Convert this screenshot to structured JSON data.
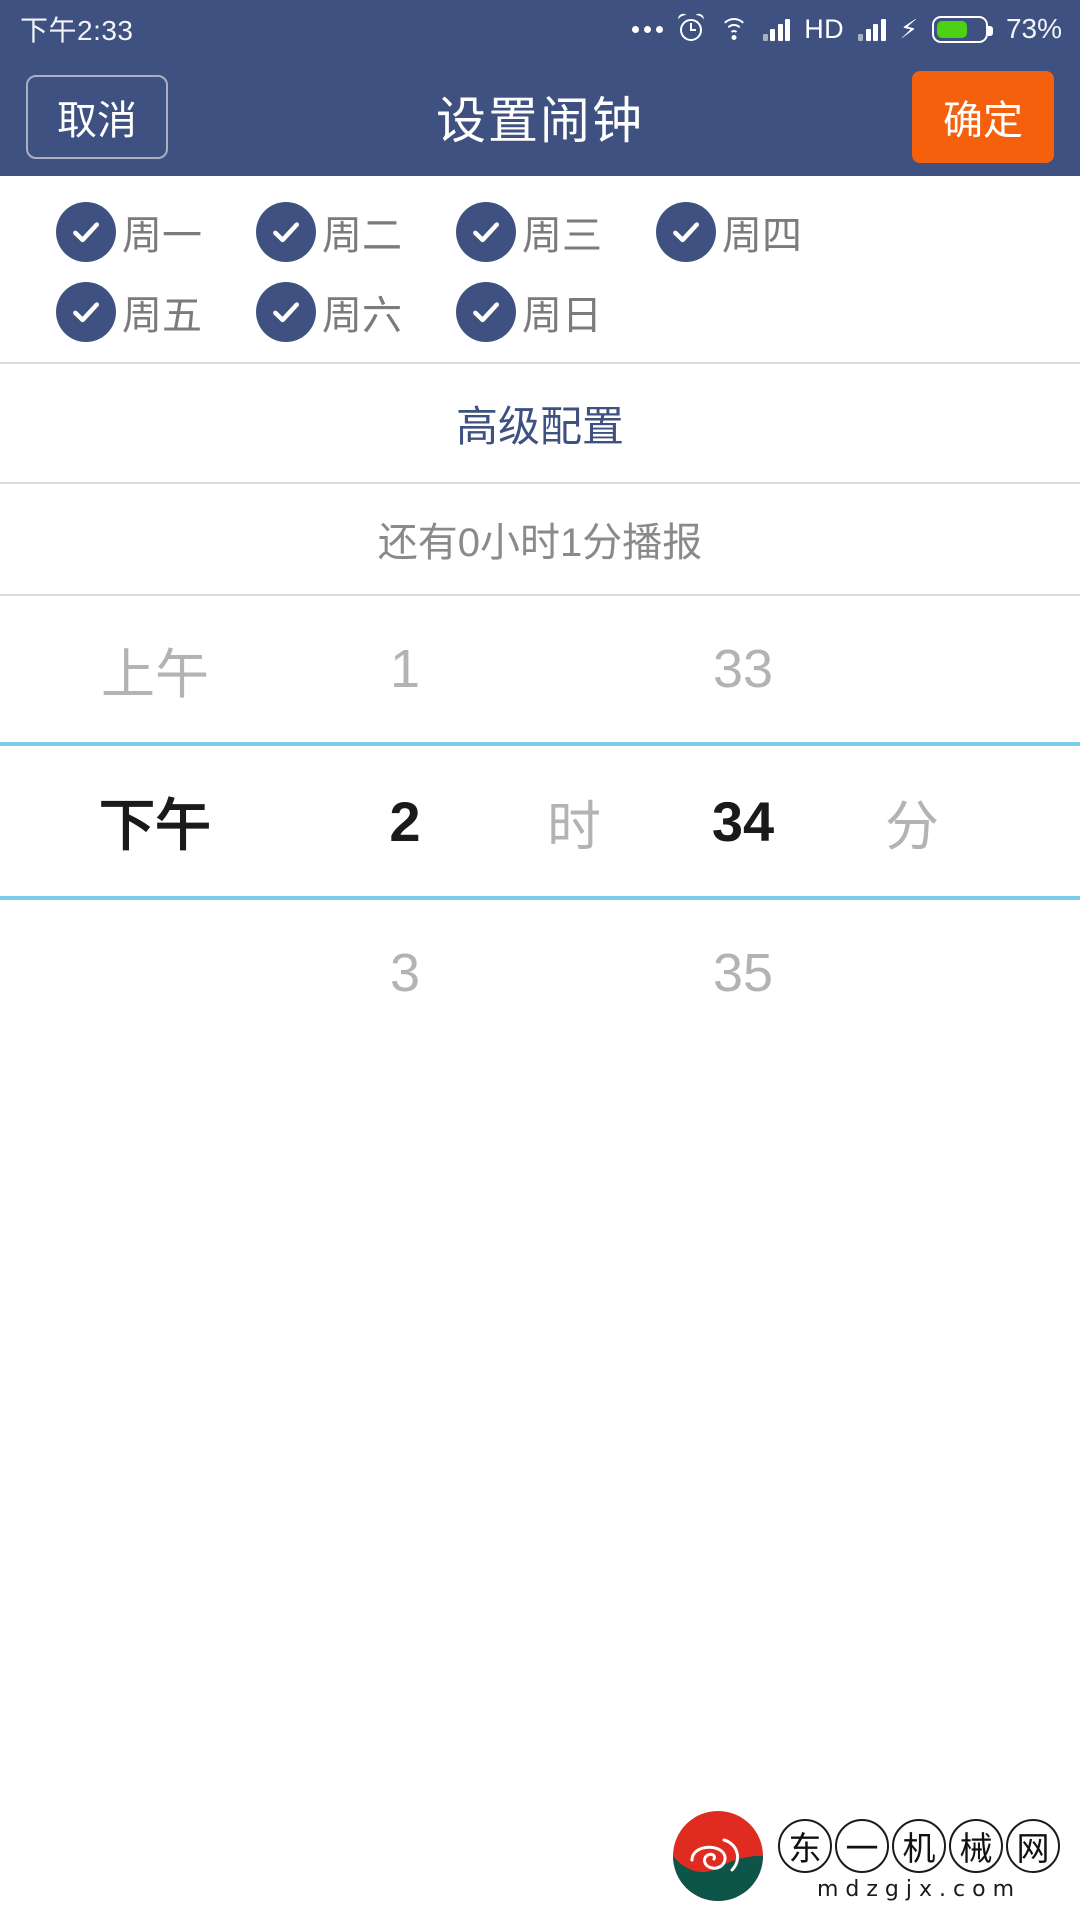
{
  "status_bar": {
    "time": "下午2:33",
    "icons": [
      "more-dots-icon",
      "alarm-clock-icon",
      "wifi-icon",
      "signal-bars-icon",
      "hd-icon",
      "signal-bars-2-icon",
      "charging-bolt-icon",
      "battery-icon"
    ],
    "hd_label": "HD",
    "bolt_glyph": "⚡",
    "battery_percent": "73%",
    "battery_level": 73,
    "battery_fill_color": "#4cd212",
    "background_color": "#3e5180",
    "text_color": "#f2f4f8"
  },
  "header": {
    "cancel_label": "取消",
    "title": "设置闹钟",
    "confirm_label": "确定",
    "background_color": "#3e5180",
    "confirm_color": "#f4600c"
  },
  "weekdays": {
    "check_glyph": "✓",
    "circle_color": "#3e5180",
    "label_color": "#7b7b7b",
    "rows": [
      [
        {
          "label": "周一",
          "checked": true
        },
        {
          "label": "周二",
          "checked": true
        },
        {
          "label": "周三",
          "checked": true
        },
        {
          "label": "周四",
          "checked": true
        }
      ],
      [
        {
          "label": "周五",
          "checked": true
        },
        {
          "label": "周六",
          "checked": true
        },
        {
          "label": "周日",
          "checked": true
        }
      ]
    ]
  },
  "advanced": {
    "label": "高级配置",
    "color": "#3e5180"
  },
  "countdown": {
    "text": "还有0小时1分播报",
    "color": "#8a8a8a"
  },
  "time_picker": {
    "highlight_color": "#79cdeb",
    "dim_color": "#b3b3b3",
    "selected_color": "#1a1a1a",
    "hour_unit": "时",
    "minute_unit": "分",
    "rows": {
      "above": {
        "ampm": "上午",
        "hour": "1",
        "minute": "33"
      },
      "selected": {
        "ampm": "下午",
        "hour": "2",
        "minute": "34"
      },
      "below": {
        "ampm": "",
        "hour": "3",
        "minute": "35"
      }
    }
  },
  "watermark": {
    "chars": [
      "东",
      "一",
      "机",
      "械",
      "网"
    ],
    "url": "mdzgjx.com",
    "badge_red": "#e02b20",
    "badge_green": "#0d5449"
  }
}
